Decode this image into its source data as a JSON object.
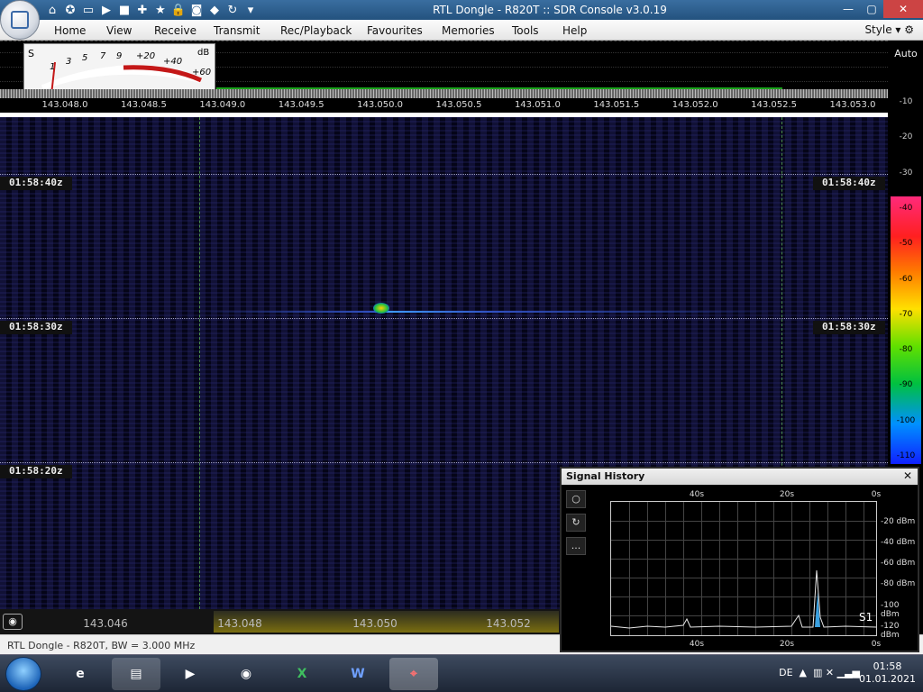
{
  "window": {
    "title": "RTL Dongle - R820T :: SDR Console v3.0.19"
  },
  "ribbon": {
    "tabs": [
      "Home",
      "View",
      "Receive",
      "Transmit",
      "Rec/Playback",
      "Favourites",
      "Memories",
      "Tools",
      "Help"
    ],
    "style_label": "Style"
  },
  "smeter": {
    "s_label": "S",
    "db_label": "dB",
    "s_scale": [
      "1",
      "3",
      "5",
      "7",
      "9"
    ],
    "db_scale": [
      "+20",
      "+40",
      "+60"
    ]
  },
  "spectrum": {
    "freq_labels": [
      "143.048.0",
      "143.048.5",
      "143.049.0",
      "143.049.5",
      "143.050.0",
      "143.050.5",
      "143.051.0",
      "143.051.5",
      "143.052.0",
      "143.052.5",
      "143.053.0"
    ]
  },
  "scale": {
    "auto_label": "Auto",
    "levels": [
      "-10",
      "-20",
      "-30",
      "-40",
      "-50",
      "-60",
      "-70",
      "-80",
      "-90",
      "-100",
      "-110"
    ]
  },
  "waterfall": {
    "timestamps": [
      "01:58:40z",
      "01:58:30z",
      "01:58:20z"
    ]
  },
  "freqbar": {
    "labels": [
      "143.046",
      "143.048",
      "143.050",
      "143.052"
    ]
  },
  "status": {
    "text": "RTL Dongle - R820T, BW = 3.000 MHz"
  },
  "signal_history": {
    "title": "Signal History",
    "close": "✕",
    "x_ticks": [
      "40s",
      "20s",
      "0s"
    ],
    "y_ticks": [
      "-20 dBm",
      "-40 dBm",
      "-60 dBm",
      "-80 dBm",
      "-100 dBm",
      "-120 dBm"
    ],
    "marker": "S1",
    "buttons": [
      "○",
      "↻",
      "..."
    ]
  },
  "taskbar": {
    "lang": "DE",
    "time": "01:58",
    "date": "01.01.2021"
  },
  "colors": {
    "accent": "#23527e",
    "signal": "#19a11a",
    "close": "#cc4444"
  }
}
